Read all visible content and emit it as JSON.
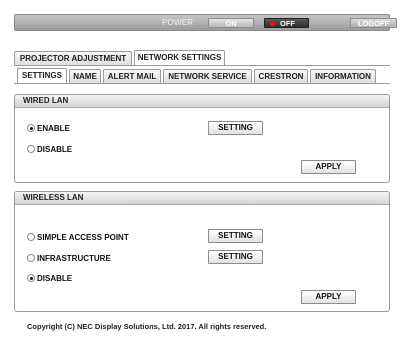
{
  "top_bar": {
    "power_label": "POWER",
    "on_label": "ON",
    "off_label": "OFF",
    "logoff_label": "LOGOFF"
  },
  "main_tabs": [
    {
      "label": "PROJECTOR ADJUSTMENT",
      "active": false
    },
    {
      "label": "NETWORK SETTINGS",
      "active": true
    }
  ],
  "sub_tabs": [
    {
      "label": "SETTINGS",
      "active": true
    },
    {
      "label": "NAME",
      "active": false
    },
    {
      "label": "ALERT MAIL",
      "active": false
    },
    {
      "label": "NETWORK SERVICE",
      "active": false
    },
    {
      "label": "CRESTRON",
      "active": false
    },
    {
      "label": "INFORMATION",
      "active": false
    }
  ],
  "wired_lan": {
    "title": "WIRED LAN",
    "options": [
      {
        "label": "ENABLE",
        "selected": true
      },
      {
        "label": "DISABLE",
        "selected": false
      }
    ],
    "setting_button": "SETTING",
    "apply_button": "APPLY"
  },
  "wireless_lan": {
    "title": "WIRELESS LAN",
    "options": [
      {
        "label": "SIMPLE ACCESS POINT",
        "selected": false
      },
      {
        "label": "INFRASTRUCTURE",
        "selected": false
      },
      {
        "label": "DISABLE",
        "selected": true
      }
    ],
    "setting_button_1": "SETTING",
    "setting_button_2": "SETTING",
    "apply_button": "APPLY"
  },
  "footer": {
    "copyright": "Copyright (C) NEC Display Solutions, Ltd. 2017. All rights reserved."
  },
  "colors": {
    "led_off": "#e01212",
    "bar": "#b5b5b5"
  }
}
